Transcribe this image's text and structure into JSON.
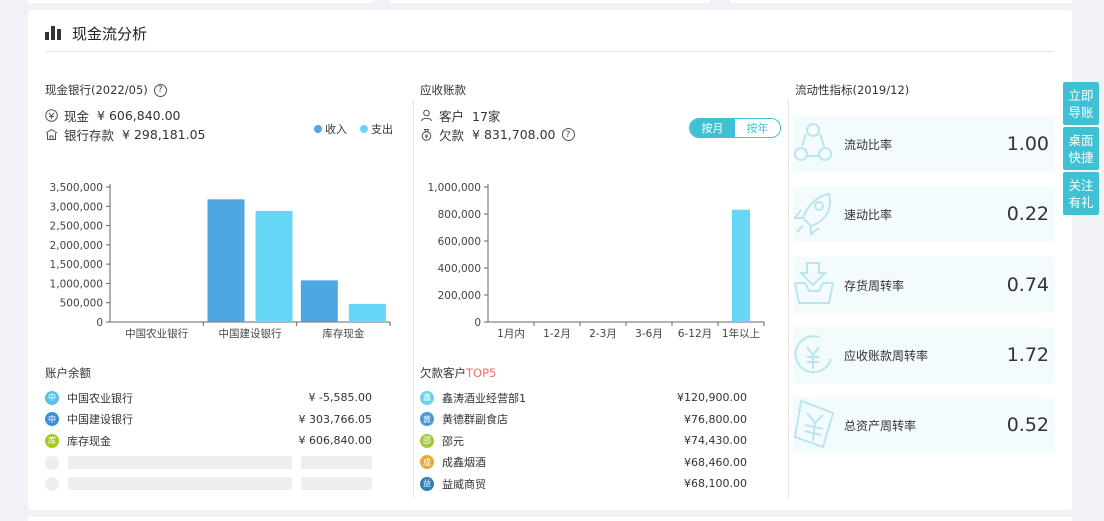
{
  "section_title": "现金流分析",
  "cash": {
    "label": "现金银行(2022/05)",
    "cash_label": "现金",
    "cash_value": "¥ 606,840.00",
    "bank_label": "银行存款",
    "bank_value": "¥ 298,181.05",
    "legend": [
      {
        "name": "收入",
        "color": "#4fa7e2"
      },
      {
        "name": "支出",
        "color": "#66d6f6"
      }
    ],
    "chart_data": {
      "type": "bar",
      "categories": [
        "中国农业银行",
        "中国建设银行",
        "库存现金"
      ],
      "series": [
        {
          "name": "收入",
          "values": [
            0,
            3180000,
            1080000
          ]
        },
        {
          "name": "支出",
          "values": [
            0,
            2880000,
            470000
          ]
        }
      ],
      "yticks": [
        "0",
        "500,000",
        "1,000,000",
        "1,500,000",
        "2,000,000",
        "2,500,000",
        "3,000,000",
        "3,500,000"
      ],
      "ylim": [
        0,
        3500000
      ]
    },
    "balance_label": "账户余额",
    "accounts": [
      {
        "icon": "中",
        "color": "#5bbfe8",
        "name": "中国农业银行",
        "amount": "¥ -5,585.00"
      },
      {
        "icon": "中",
        "color": "#3f8fd6",
        "name": "中国建设银行",
        "amount": "¥ 303,766.05"
      },
      {
        "icon": "库",
        "color": "#a6c928",
        "name": "库存现金",
        "amount": "¥ 606,840.00"
      }
    ]
  },
  "receivable": {
    "label": "应收账款",
    "customer_label": "客户",
    "customer_value": "17家",
    "debt_label": "欠款",
    "debt_value": "¥ 831,708.00",
    "toggle": {
      "monthly": "按月",
      "yearly": "按年"
    },
    "chart_data": {
      "type": "bar",
      "categories": [
        "1月内",
        "1-2月",
        "2-3月",
        "3-6月",
        "6-12月",
        "1年以上"
      ],
      "values": [
        0,
        0,
        0,
        0,
        0,
        831708
      ],
      "yticks": [
        "0",
        "200,000",
        "400,000",
        "600,000",
        "800,000",
        "1,000,000"
      ],
      "ylim": [
        0,
        1000000
      ],
      "color": "#66d6f6"
    },
    "top_label_prefix": "欠款客户",
    "top_label_suffix": "TOP5",
    "top_customers": [
      {
        "icon": "鑫",
        "color": "#6ed0e9",
        "name": "鑫涛酒业经营部1",
        "amount": "¥120,900.00"
      },
      {
        "icon": "黄",
        "color": "#4c97d6",
        "name": "黄德群副食店",
        "amount": "¥76,800.00"
      },
      {
        "icon": "邵",
        "color": "#a3c83b",
        "name": "邵元",
        "amount": "¥74,430.00"
      },
      {
        "icon": "成",
        "color": "#e8a93b",
        "name": "成鑫烟酒",
        "amount": "¥68,460.00"
      },
      {
        "icon": "益",
        "color": "#2f7fb5",
        "name": "益威商贸",
        "amount": "¥68,100.00"
      }
    ]
  },
  "liquidity": {
    "label": "流动性指标(2019/12)",
    "items": [
      {
        "icon": "cycle-icon",
        "name": "流动比率",
        "value": "1.00"
      },
      {
        "icon": "rocket-icon",
        "name": "速动比率",
        "value": "0.22"
      },
      {
        "icon": "inventory-icon",
        "name": "存货周转率",
        "value": "0.74"
      },
      {
        "icon": "receivable-icon",
        "name": "应收账款周转率",
        "value": "1.72"
      },
      {
        "icon": "yen-icon",
        "name": "总资产周转率",
        "value": "0.52"
      }
    ]
  },
  "side_tabs": [
    "立即导账",
    "桌面快捷",
    "关注有礼"
  ],
  "colors": {
    "accent": "#3fc1d3",
    "income": "#4fa7e2",
    "expense": "#66d6f6",
    "highlight": "#f06e6e"
  }
}
